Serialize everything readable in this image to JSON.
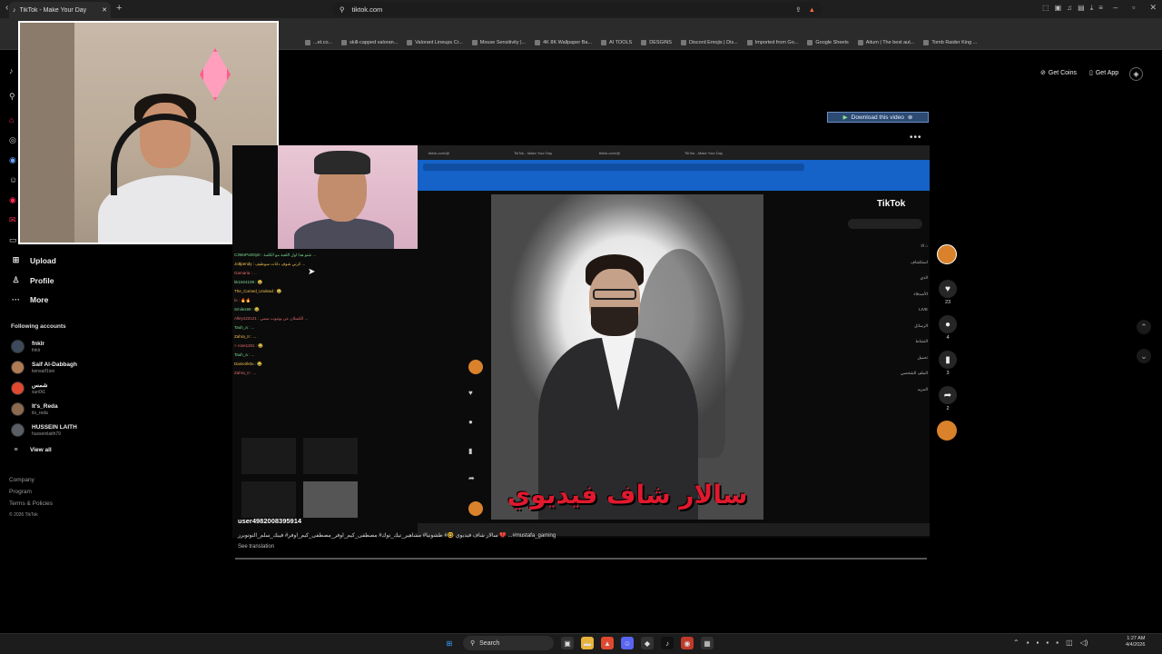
{
  "browser": {
    "tab_title": "TikTok - Make Your Day",
    "url": "tiktok.com",
    "bookmarks": [
      "...et.co...",
      "skill-capped valoran...",
      "Valorant Lineups Cr...",
      "Mouse Sensitivity |...",
      "4K 8K Wallpaper Ba...",
      "AI TOOLS",
      "DESGINS",
      "Discord Emojis | Dis...",
      "Imported from Go...",
      "Google Sheets",
      "Aitum | The best aut...",
      "Tomb Raider King ..."
    ]
  },
  "sidebar": {
    "nav": [
      {
        "label": "Upload",
        "icon": "upload-icon"
      },
      {
        "label": "Profile",
        "icon": "profile-icon"
      },
      {
        "label": "More",
        "icon": "more-icon"
      }
    ],
    "following_title": "Following accounts",
    "accounts": [
      {
        "name": "fnklr",
        "handle": "fnklr"
      },
      {
        "name": "Saif Al-Dabbagh",
        "handle": "kensaif1ion"
      },
      {
        "name": "شمس",
        "handle": "sun0t1"
      },
      {
        "name": "It's_Reda",
        "handle": "its_reda"
      },
      {
        "name": "HUSSEIN LAITH",
        "handle": "husseinlaith79"
      }
    ],
    "view_all": "View all",
    "footer": [
      "Company",
      "Program",
      "Terms & Policies",
      "© 2026 TikTok"
    ]
  },
  "header": {
    "get_coins": "Get Coins",
    "get_app": "Get App"
  },
  "download_button": "Download this video",
  "video": {
    "overlay_text": "سالار شاف فيديوي",
    "inner_logo": "TikTok",
    "username": "user4982008395914",
    "caption": "سالار شاف فيديوي 🤓# طشونيا# مشاهير_تيك_توك# مصطفى_كيم_اوفر_مصطفى_كيم_اوفر# فيبك_سلم_النوتوبرز 💔 ...#mustafa_gaming",
    "see_translation": "See translation"
  },
  "actions": {
    "likes": "23",
    "comments": "4",
    "saves": "3",
    "shares": "2"
  },
  "stream_chat": [
    "C3MoPo0Op0 : شنو هذا اول اللعبة مو الكلمة ...",
    "Jo$pendy : كرتي شوف دانات سوطيف ...",
    "Gamaria : ...",
    "kk1924108 : 😂",
    "The_Cursed_Undead : 😂",
    "lo : 🔥🔥",
    "Smiles99 : 😂",
    "",
    "Alley122121 : الكسلان عن يوتيوب سمي ...",
    "Tauh_a : ...",
    "Zahra_II : ...",
    "> rose1201 : 😂",
    "Tauh_a : ...",
    "Danie2k0u : 😂",
    "Zahra_II : ..."
  ],
  "taskbar": {
    "search": "Search",
    "time": "1:27 AM",
    "date": "4/4/2026"
  }
}
